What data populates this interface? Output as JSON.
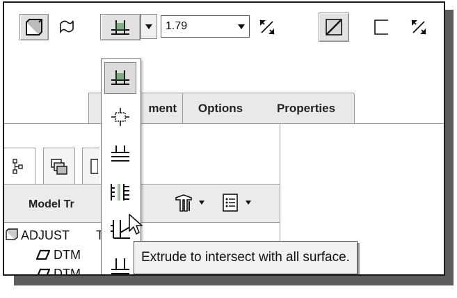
{
  "toolbar": {
    "depth_value": "1.79",
    "icons": [
      "solid-icon",
      "surface-icon",
      "depth-blind-icon",
      "flip-direction-icon",
      "remove-material-icon",
      "thicken-sketch-icon"
    ]
  },
  "depth_menu": {
    "items": [
      "blind-depth-icon",
      "symmetric-depth-icon",
      "to-next-icon",
      "through-all-icon",
      "through-until-icon",
      "to-selected-icon"
    ]
  },
  "tabs": [
    {
      "label": "Placement",
      "visible_label": "ment"
    },
    {
      "label": "Options"
    },
    {
      "label": "Properties"
    }
  ],
  "panel": {
    "title": "Model Tr",
    "tree": [
      {
        "label": "ADJUST",
        "suffix": "T",
        "icon": "part-icon"
      },
      {
        "label": "DTM",
        "icon": "datum-plane-icon"
      },
      {
        "label": "DTM",
        "icon": "datum-plane-icon"
      }
    ]
  },
  "tooltip": {
    "text": "Extrude to intersect with all surface."
  },
  "colors": {
    "toolbar_bg": "#ffffff",
    "pressed_button": "#e2e2e2",
    "tab_bg": "#e9e9e9",
    "tooltip_bg": "#f1f1f1",
    "shadow": "#5c5c5c"
  }
}
